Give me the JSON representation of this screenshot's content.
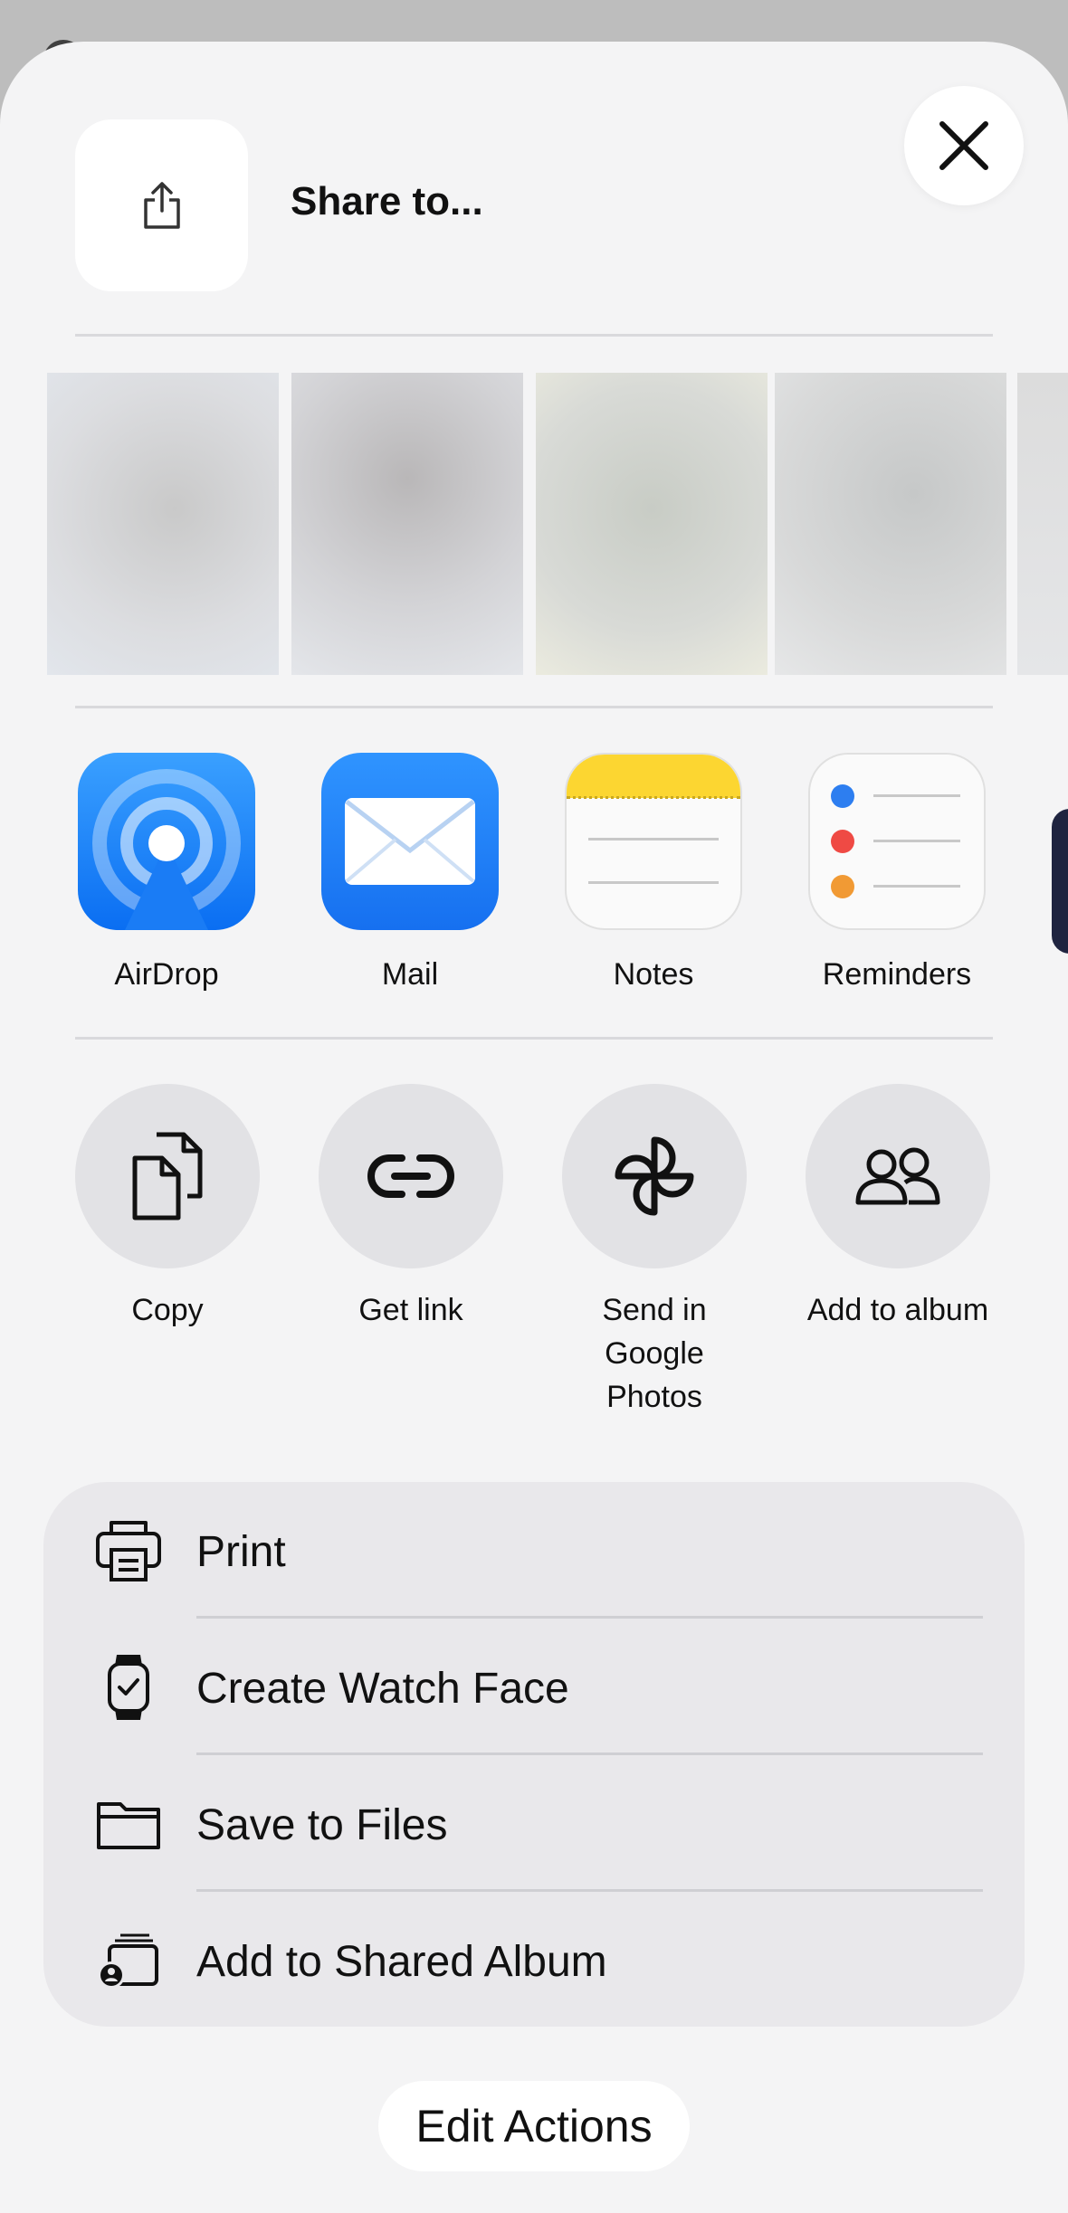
{
  "header": {
    "title": "Share to..."
  },
  "apps": [
    {
      "label": "AirDrop",
      "icon": "airdrop-icon"
    },
    {
      "label": "Mail",
      "icon": "mail-icon"
    },
    {
      "label": "Notes",
      "icon": "notes-icon"
    },
    {
      "label": "Reminders",
      "icon": "reminders-icon"
    }
  ],
  "actions": [
    {
      "label": "Copy",
      "icon": "copy-icon"
    },
    {
      "label": "Get link",
      "icon": "link-icon"
    },
    {
      "label": "Send in Google Photos",
      "icon": "pinwheel-icon"
    },
    {
      "label": "Add to album",
      "icon": "people-icon"
    }
  ],
  "list": [
    {
      "label": "Print",
      "icon": "printer-icon"
    },
    {
      "label": "Create Watch Face",
      "icon": "watch-icon"
    },
    {
      "label": "Save to Files",
      "icon": "folder-icon"
    },
    {
      "label": "Add to Shared Album",
      "icon": "shared-album-icon"
    }
  ],
  "edit_actions_label": "Edit Actions",
  "colors": {
    "sheet_bg": "#f4f4f5",
    "accent_blue": "#1a7cf5",
    "notes_yellow": "#fcd631"
  }
}
